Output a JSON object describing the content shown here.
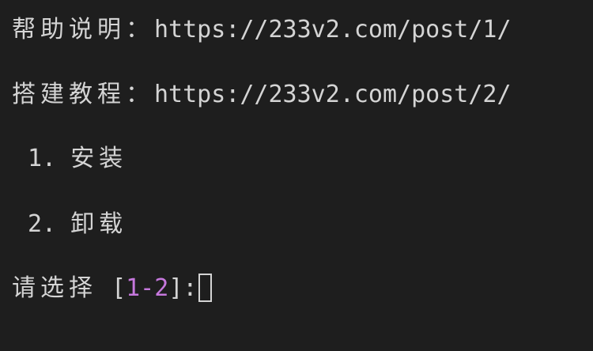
{
  "lines": {
    "help": {
      "label": "帮助说明：",
      "url": "https://233v2.com/post/1/"
    },
    "tutorial": {
      "label": "搭建教程：",
      "url": "https://233v2.com/post/2/"
    },
    "options": [
      {
        "number": "1.",
        "label": "安装"
      },
      {
        "number": "2.",
        "label": "卸载"
      }
    ],
    "prompt": {
      "label": "请选择",
      "open_bracket": "[",
      "range": "1-2",
      "close_bracket": "]:"
    }
  },
  "colors": {
    "background": "#1e1e1e",
    "text": "#d4d4d4",
    "range_accent": "#c678dd"
  }
}
